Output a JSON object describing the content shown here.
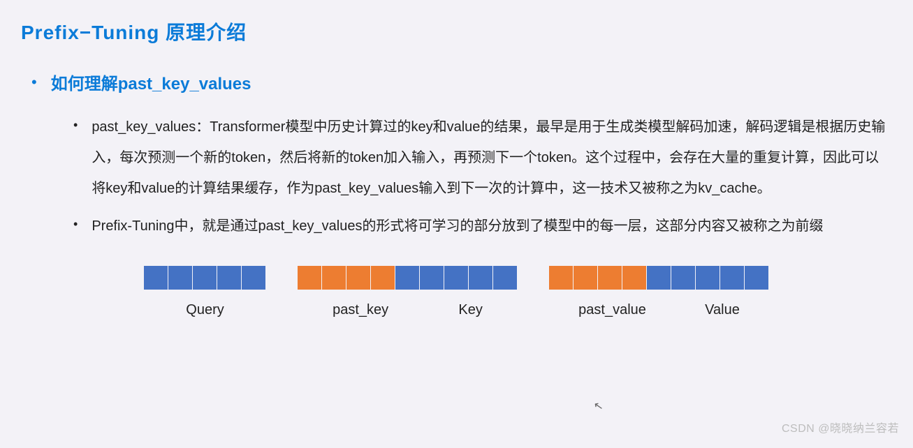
{
  "title": "Prefix−Tuning  原理介绍",
  "section": {
    "heading": "如何理解past_key_values",
    "items": [
      "past_key_values：Transformer模型中历史计算过的key和value的结果，最早是用于生成类模型解码加速，解码逻辑是根据历史输入，每次预测一个新的token，然后将新的token加入输入，再预测下一个token。这个过程中，会存在大量的重复计算，因此可以将key和value的计算结果缓存，作为past_key_values输入到下一次的计算中，这一技术又被称之为kv_cache。",
      "Prefix-Tuning中，就是通过past_key_values的形式将可学习的部分放到了模型中的每一层，这部分内容又被称之为前缀"
    ]
  },
  "diagram": {
    "groups": [
      {
        "segments": [
          {
            "color": "blue",
            "count": 5
          }
        ],
        "labels": [
          "Query"
        ]
      },
      {
        "segments": [
          {
            "color": "orange",
            "count": 4
          },
          {
            "color": "blue",
            "count": 5
          }
        ],
        "labels": [
          "past_key",
          "Key"
        ]
      },
      {
        "segments": [
          {
            "color": "orange",
            "count": 4
          },
          {
            "color": "blue",
            "count": 5
          }
        ],
        "labels": [
          "past_value",
          "Value"
        ]
      }
    ]
  },
  "watermark": "CSDN @晓晓纳兰容若",
  "colors": {
    "blue": "#4472c4",
    "orange": "#ed7d31",
    "title_blue": "#0b7bd8"
  }
}
